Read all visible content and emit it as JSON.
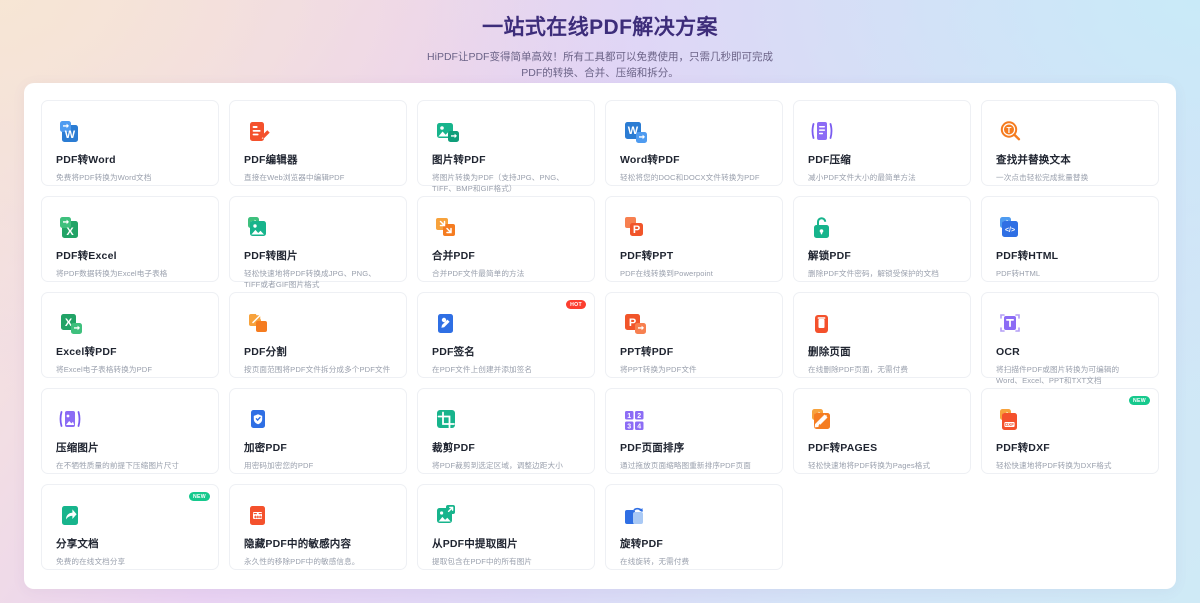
{
  "hero": {
    "title": "一站式在线PDF解决方案",
    "subtitle_line1": "HiPDF让PDF变得简单高效！所有工具都可以免费使用，只需几秒即可完成",
    "subtitle_line2": "PDF的转换、合并、压缩和拆分。"
  },
  "badges": {
    "hot": "HOT",
    "new": "NEW"
  },
  "colors": {
    "word_blue": "#2b7cd3",
    "excel_green": "#21a366",
    "ppt_orange": "#f1552a",
    "image_green": "#17b48c",
    "purple": "#7a5cf0",
    "orange": "#f57c20",
    "red": "#f4512c",
    "blue": "#2f6fe4",
    "title_purple": "#3d2d7a"
  },
  "tools": [
    {
      "id": 1,
      "icon": "pdf-to-word-icon",
      "title": "PDF转Word",
      "desc": "免费将PDF转换为Word文档",
      "badge": null
    },
    {
      "id": 2,
      "icon": "pdf-editor-icon",
      "title": "PDF编辑器",
      "desc": "直接在Web浏览器中编辑PDF",
      "badge": null
    },
    {
      "id": 3,
      "icon": "image-to-pdf-icon",
      "title": "图片转PDF",
      "desc": "将图片转换为PDF（支持JPG、PNG、TIFF、BMP和GIF格式）",
      "badge": null
    },
    {
      "id": 4,
      "icon": "word-to-pdf-icon",
      "title": "Word转PDF",
      "desc": "轻松将您的DOC和DOCX文件转换为PDF",
      "badge": null
    },
    {
      "id": 5,
      "icon": "compress-pdf-icon",
      "title": "PDF压缩",
      "desc": "减小PDF文件大小的最简单方法",
      "badge": null
    },
    {
      "id": 6,
      "icon": "find-replace-text-icon",
      "title": "查找并替换文本",
      "desc": "一次点击轻松完成批量替换",
      "badge": null
    },
    {
      "id": 7,
      "icon": "pdf-to-excel-icon",
      "title": "PDF转Excel",
      "desc": "将PDF数据转换为Excel电子表格",
      "badge": null
    },
    {
      "id": 8,
      "icon": "pdf-to-image-icon",
      "title": "PDF转图片",
      "desc": "轻松快速地将PDF转换成JPG、PNG、TIFF或者GIF图片格式",
      "badge": null
    },
    {
      "id": 9,
      "icon": "merge-pdf-icon",
      "title": "合并PDF",
      "desc": "合并PDF文件最简单的方法",
      "badge": null
    },
    {
      "id": 10,
      "icon": "pdf-to-ppt-icon",
      "title": "PDF转PPT",
      "desc": "PDF在线转换到Powerpoint",
      "badge": null
    },
    {
      "id": 11,
      "icon": "unlock-pdf-icon",
      "title": "解锁PDF",
      "desc": "删除PDF文件密码，解锁受保护的文档",
      "badge": null
    },
    {
      "id": 12,
      "icon": "pdf-to-html-icon",
      "title": "PDF转HTML",
      "desc": "PDF转HTML",
      "badge": null
    },
    {
      "id": 13,
      "icon": "excel-to-pdf-icon",
      "title": "Excel转PDF",
      "desc": "将Excel电子表格转换为PDF",
      "badge": null
    },
    {
      "id": 14,
      "icon": "split-pdf-icon",
      "title": "PDF分割",
      "desc": "按页面范围将PDF文件拆分成多个PDF文件",
      "badge": null
    },
    {
      "id": 15,
      "icon": "sign-pdf-icon",
      "title": "PDF签名",
      "desc": "在PDF文件上创建并添加签名",
      "badge": "HOT"
    },
    {
      "id": 16,
      "icon": "ppt-to-pdf-icon",
      "title": "PPT转PDF",
      "desc": "将PPT转换为PDF文件",
      "badge": null
    },
    {
      "id": 17,
      "icon": "delete-pages-icon",
      "title": "删除页面",
      "desc": "在线删除PDF页面，无需付费",
      "badge": null
    },
    {
      "id": 18,
      "icon": "ocr-icon",
      "title": "OCR",
      "desc": "将扫描件PDF或图片转换为可编辑的Word、Excel、PPT和TXT文档",
      "badge": null
    },
    {
      "id": 19,
      "icon": "compress-image-icon",
      "title": "压缩图片",
      "desc": "在不牺牲质量的前提下压缩图片尺寸",
      "badge": null
    },
    {
      "id": 20,
      "icon": "protect-pdf-icon",
      "title": "加密PDF",
      "desc": "用密码加密您的PDF",
      "badge": null
    },
    {
      "id": 21,
      "icon": "crop-pdf-icon",
      "title": "裁剪PDF",
      "desc": "将PDF裁剪到选定区域，调整边距大小",
      "badge": null
    },
    {
      "id": 22,
      "icon": "organize-pages-icon",
      "title": "PDF页面排序",
      "desc": "通过拖放页面缩略图重新排序PDF页面",
      "badge": null
    },
    {
      "id": 23,
      "icon": "pdf-to-pages-icon",
      "title": "PDF转PAGES",
      "desc": "轻松快速地将PDF转换为Pages格式",
      "badge": null
    },
    {
      "id": 24,
      "icon": "pdf-to-dxf-icon",
      "title": "PDF转DXF",
      "desc": "轻松快速地将PDF转换为DXF格式",
      "badge": "NEW"
    },
    {
      "id": 25,
      "icon": "share-document-icon",
      "title": "分享文档",
      "desc": "免费的在线文档分享",
      "badge": "NEW"
    },
    {
      "id": 26,
      "icon": "redact-pdf-icon",
      "title": "隐藏PDF中的敏感内容",
      "desc": "永久性的移除PDF中的敏感信息。",
      "badge": null
    },
    {
      "id": 27,
      "icon": "extract-images-icon",
      "title": "从PDF中提取图片",
      "desc": "提取包含在PDF中的所有图片",
      "badge": null
    },
    {
      "id": 28,
      "icon": "rotate-pdf-icon",
      "title": "旋转PDF",
      "desc": "在线旋转，无需付费",
      "badge": null
    }
  ]
}
